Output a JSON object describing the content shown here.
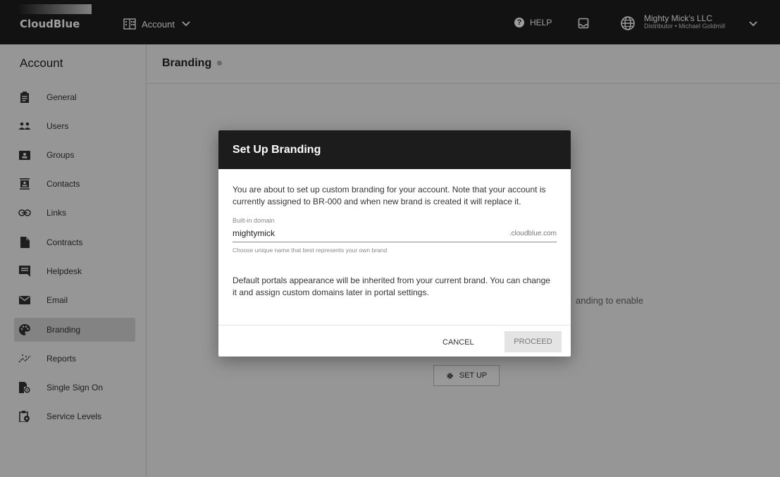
{
  "topbar": {
    "logo_text": "CloudBlue",
    "account_switch": "Account",
    "help": "HELP",
    "user_name": "Mighty Mick's LLC",
    "user_role": "Distributor • Michael Goldmill"
  },
  "sidebar": {
    "title": "Account",
    "items": [
      {
        "label": "General",
        "icon": "clipboard-icon"
      },
      {
        "label": "Users",
        "icon": "users-icon"
      },
      {
        "label": "Groups",
        "icon": "groups-icon"
      },
      {
        "label": "Contacts",
        "icon": "contacts-icon"
      },
      {
        "label": "Links",
        "icon": "link-icon"
      },
      {
        "label": "Contracts",
        "icon": "document-icon"
      },
      {
        "label": "Helpdesk",
        "icon": "chat-icon"
      },
      {
        "label": "Email",
        "icon": "email-icon"
      },
      {
        "label": "Branding",
        "icon": "palette-icon",
        "active": true
      },
      {
        "label": "Reports",
        "icon": "reports-icon"
      },
      {
        "label": "Single Sign On",
        "icon": "sso-icon"
      },
      {
        "label": "Service Levels",
        "icon": "service-levels-icon"
      }
    ]
  },
  "main": {
    "title": "Branding",
    "background_text": "anding to enable",
    "setup_button": "SET UP"
  },
  "modal": {
    "title": "Set Up Branding",
    "intro": "You are about to set up custom branding for your account. Note that your account is currently assigned to BR-000 and when new brand is created it will replace it.",
    "field_label": "Built-in domain",
    "field_value": "mightymick",
    "field_suffix": ".cloudblue.com",
    "field_hint": "Choose unique name that best represents your own brand",
    "note": "Default portals appearance will be inherited from your current brand. You can change it and assign custom domains later in portal settings.",
    "cancel": "CANCEL",
    "proceed": "PROCEED"
  },
  "colors": {
    "topbar": "#1d1d1d",
    "modal_header": "#1c1c1c",
    "sidebar_bg": "#f2f2f2",
    "active_item": "#d4d4d4"
  }
}
